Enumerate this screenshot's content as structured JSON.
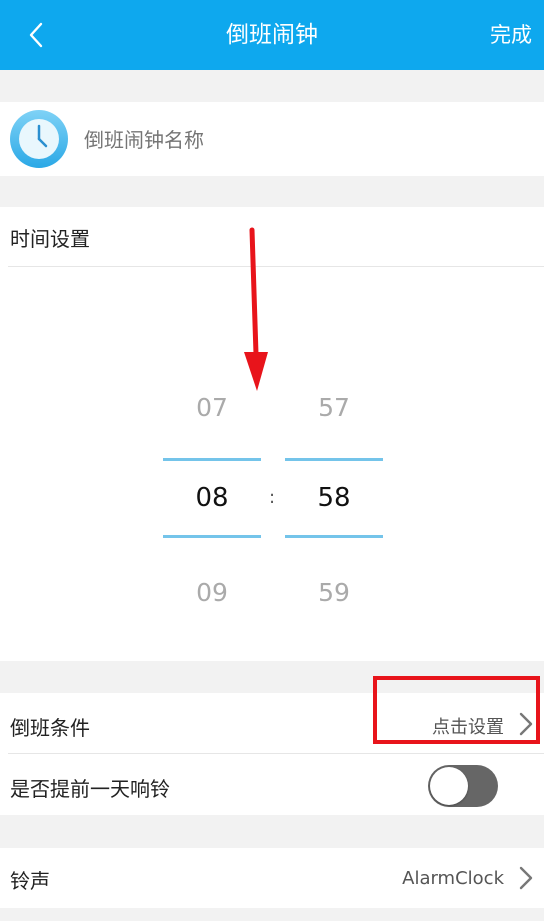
{
  "header": {
    "title": "倒班闹钟",
    "done_label": "完成"
  },
  "name_field": {
    "placeholder": "倒班闹钟名称"
  },
  "time_settings": {
    "label": "时间设置",
    "hour": {
      "prev": "07",
      "selected": "08",
      "next": "09"
    },
    "minute": {
      "prev": "57",
      "selected": "58",
      "next": "59"
    },
    "separator": ":"
  },
  "shift_condition": {
    "label": "倒班条件",
    "value": "点击设置"
  },
  "ring_day_before": {
    "label": "是否提前一天响铃",
    "enabled": false
  },
  "ringtone": {
    "label": "铃声",
    "value": "AlarmClock"
  },
  "colors": {
    "header_bg": "#0ea8ee",
    "accent_line": "#74c4ea",
    "annotation_red": "#e8141b"
  }
}
